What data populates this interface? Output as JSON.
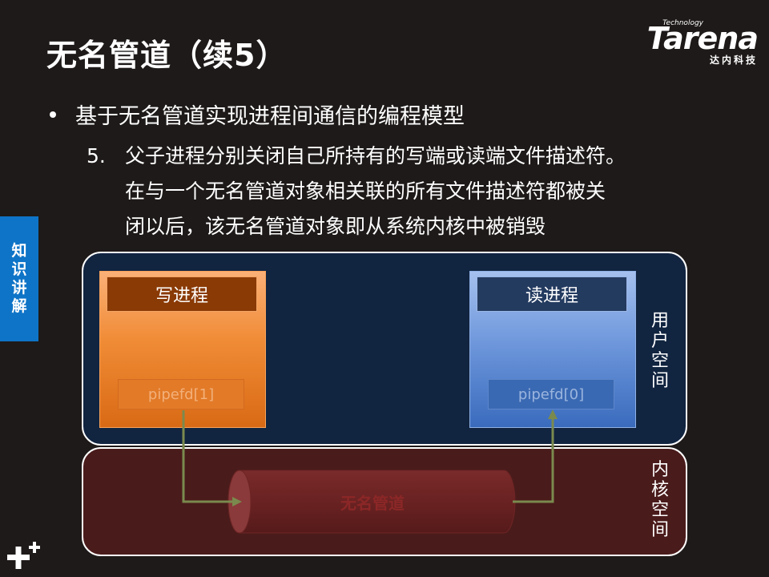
{
  "slide": {
    "title": "无名管道（续5）",
    "bullet": "基于无名管道实现进程间通信的编程模型",
    "sub_number": "5.",
    "sub_lines": [
      "父子进程分别关闭自己所持有的写端或读端文件描述符。",
      "在与一个无名管道对象相关联的所有文件描述符都被关",
      "闭以后，该无名管道对象即从系统内核中被销毁"
    ]
  },
  "logo": {
    "small": "Technology",
    "main": "Tarena",
    "sub": "达内科技"
  },
  "side_tab": {
    "chars": [
      "知",
      "识",
      "讲",
      "解"
    ]
  },
  "diagram": {
    "write_process": {
      "title": "写进程",
      "fd": "pipefd[1]"
    },
    "read_process": {
      "title": "读进程",
      "fd": "pipefd[0]"
    },
    "pipe_label": "无名管道",
    "user_space_chars": [
      "用",
      "户",
      "空",
      "间"
    ],
    "kernel_space_chars": [
      "内",
      "核",
      "空",
      "间"
    ]
  },
  "colors": {
    "background": "#1e1a19",
    "accent_blue": "#0e74c7",
    "user_space": "#112440",
    "kernel_space": "#4a1b1b",
    "write_process": "#f08b35",
    "read_process": "#6f98dc",
    "arrow": "#7a8a4e"
  }
}
